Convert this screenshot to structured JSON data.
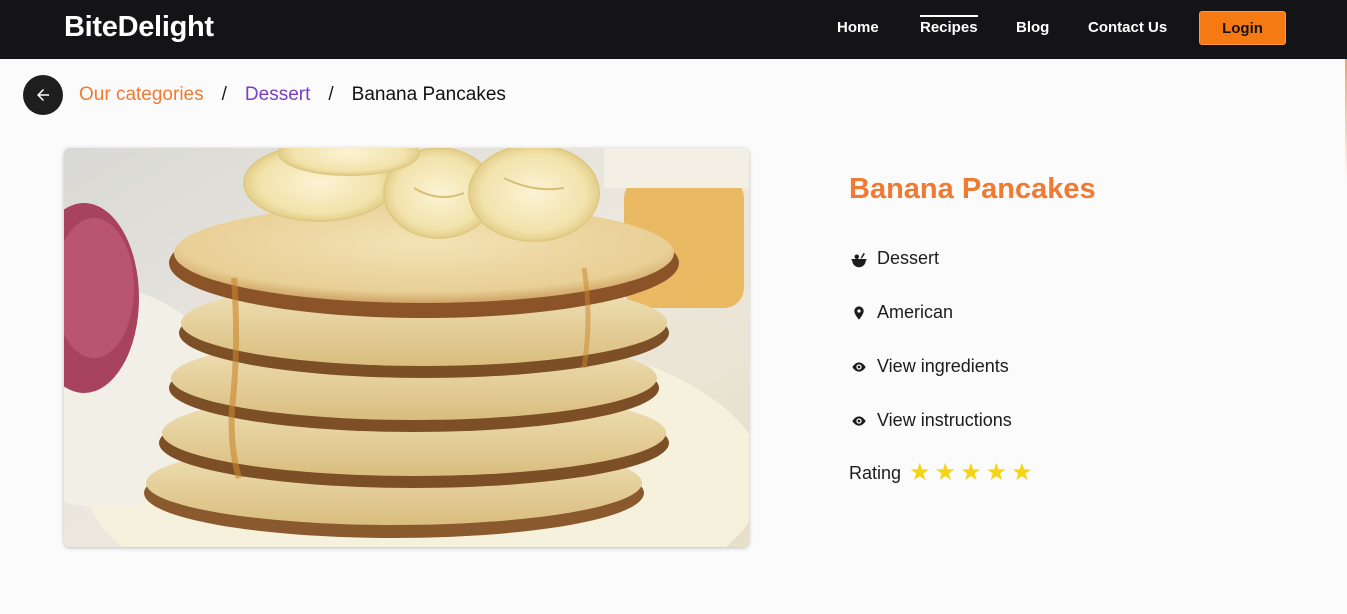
{
  "brand": "BiteDelight",
  "nav": {
    "items": [
      {
        "label": "Home",
        "active": false
      },
      {
        "label": "Recipes",
        "active": true
      },
      {
        "label": "Blog",
        "active": false
      },
      {
        "label": "Contact Us",
        "active": false
      }
    ],
    "login_label": "Login"
  },
  "breadcrumb": {
    "back_icon": "arrow-left-icon",
    "category": "Our categories",
    "separator": "/",
    "subcategory": "Dessert",
    "current": "Banana Pancakes"
  },
  "recipe": {
    "title": "Banana Pancakes",
    "image_alt": "Stack of banana pancakes with syrup",
    "category": {
      "icon": "dish-icon",
      "label": "Dessert"
    },
    "cuisine": {
      "icon": "location-pin-icon",
      "label": "American"
    },
    "ingredients_link": {
      "icon": "eye-icon",
      "label": "View ingredients"
    },
    "instructions_link": {
      "icon": "eye-icon",
      "label": "View instructions"
    },
    "rating_label": "Rating",
    "rating_value": 5,
    "rating_max": 5
  },
  "colors": {
    "navbar": "#141416",
    "accent_orange": "#f57a14",
    "title_orange": "#f07a32",
    "breadcrumb_purple": "#7b3fc4",
    "star_yellow": "#f5d416"
  }
}
